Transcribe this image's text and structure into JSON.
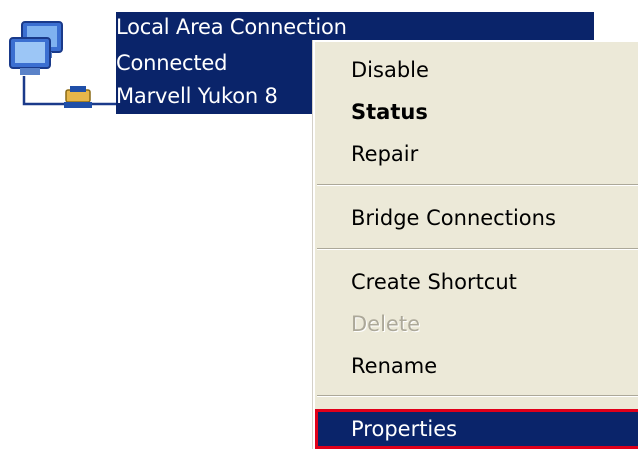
{
  "connection": {
    "name": "Local Area Connection",
    "status": "Connected",
    "device": "Marvell Yukon 8",
    "icon": "network-connection-icon"
  },
  "menu": {
    "items": [
      {
        "label": "Disable",
        "enabled": true,
        "bold": false
      },
      {
        "label": "Status",
        "enabled": true,
        "bold": true
      },
      {
        "label": "Repair",
        "enabled": true,
        "bold": false
      },
      {
        "label": "Bridge Connections",
        "enabled": true,
        "bold": false
      },
      {
        "label": "Create Shortcut",
        "enabled": true,
        "bold": false
      },
      {
        "label": "Delete",
        "enabled": false,
        "bold": false
      },
      {
        "label": "Rename",
        "enabled": true,
        "bold": false
      },
      {
        "label": "Properties",
        "enabled": true,
        "bold": false,
        "highlighted": true
      }
    ]
  },
  "colors": {
    "selection": "#0a246a",
    "menu_background": "#ece9d8",
    "highlight_outline": "#e0001a",
    "disabled_text": "#aca899"
  }
}
